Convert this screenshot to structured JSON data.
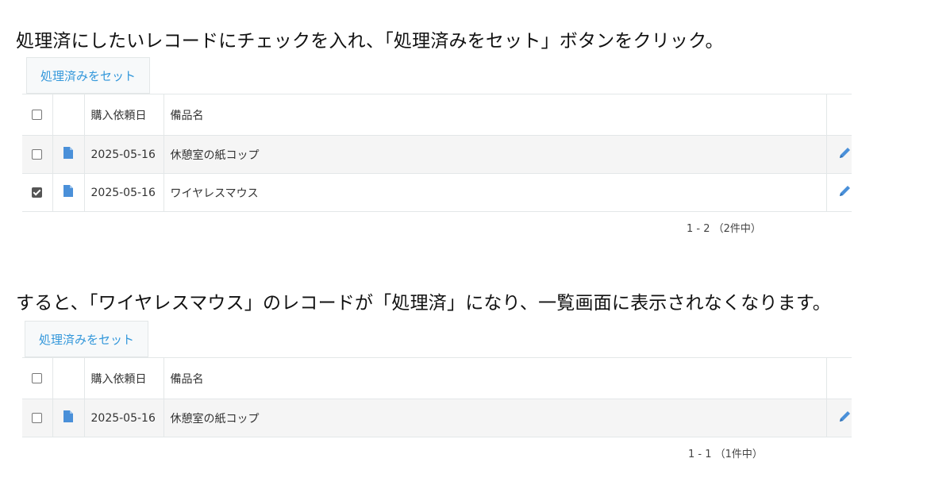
{
  "instructions": [
    "処理済にしたいレコードにチェックを入れ、「処理済みをセット」ボタンをクリック。",
    "すると、「ワイヤレスマウス」のレコードが「処理済」になり、一覧画面に表示されなくなります。"
  ],
  "colors": {
    "accent": "#3498db",
    "row_alt": "#f5f5f5",
    "border": "#e3e7e8"
  },
  "before": {
    "button_label": "処理済みをセット",
    "columns": {
      "date": "購入依頼日",
      "name": "備品名"
    },
    "rows": [
      {
        "checked": false,
        "date": "2025-05-16",
        "name": "休憩室の紙コップ"
      },
      {
        "checked": true,
        "date": "2025-05-16",
        "name": "ワイヤレスマウス"
      }
    ],
    "pagination": "1 - 2 （2件中）"
  },
  "after": {
    "button_label": "処理済みをセット",
    "columns": {
      "date": "購入依頼日",
      "name": "備品名"
    },
    "rows": [
      {
        "checked": false,
        "date": "2025-05-16",
        "name": "休憩室の紙コップ"
      }
    ],
    "pagination": "1 - 1 （1件中）"
  },
  "icons": {
    "row_icon": "document-icon",
    "edit": "pencil-icon"
  }
}
